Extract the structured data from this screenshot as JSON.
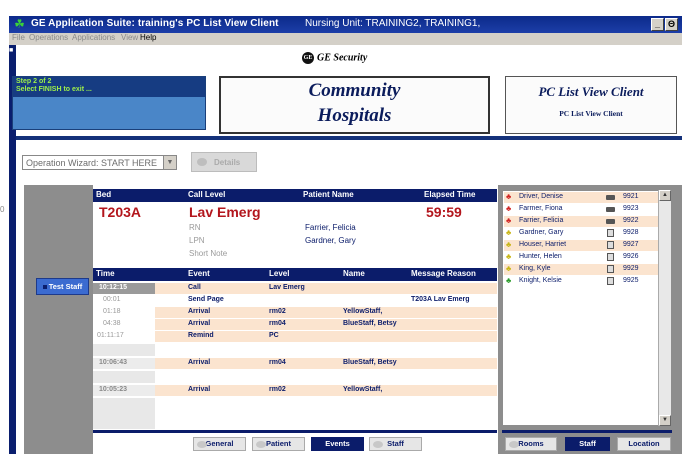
{
  "window": {
    "title": "GE Application Suite:  training's PC List View Client",
    "nursing_unit": "Nursing Unit:  TRAINING2, TRAINING1,",
    "min_label": "_",
    "restore_label": "Θ"
  },
  "menu": {
    "file": "File",
    "operations": "Operations",
    "applications": "Applications",
    "view": "View",
    "help": "Help"
  },
  "left_strip_mark": "■",
  "brand": {
    "ge_mark": "GE",
    "ge_text": "GE Security"
  },
  "step": {
    "line1": "Step 2 of 2",
    "line2": "Select FINISH to exit ..."
  },
  "hospital": {
    "line1": "Community",
    "line2": "Hospitals"
  },
  "client": {
    "line1": "PC List View Client",
    "line2": "PC List View Client"
  },
  "wizard": {
    "value": "Operation Wizard: START HERE",
    "arrow": "▼",
    "details_label": "Details"
  },
  "side_tick": "0",
  "test_staff_label": "Test Staff",
  "bed": {
    "headers": {
      "bed": "Bed",
      "call_level": "Call Level",
      "patient_name": "Patient Name",
      "elapsed": "Elapsed Time"
    },
    "bed_id": "T203A",
    "call_level": "Lav Emerg",
    "patient": "Farrier, Felicia",
    "elapsed": "59:59",
    "rn_label": "RN",
    "lpn_label": "LPN",
    "lpn_value": "Gardner, Gary",
    "short_note_label": "Short Note"
  },
  "events": {
    "headers": {
      "time": "Time",
      "event": "Event",
      "level": "Level",
      "name": "Name",
      "reason": "Message Reason"
    },
    "rows": [
      {
        "time": "10:12:15",
        "event": "Call",
        "level": "Lav Emerg",
        "name": "",
        "reason": ""
      },
      {
        "time": "00:01",
        "event": "Send Page",
        "level": "",
        "name": "",
        "reason": "T203A Lav Emerg"
      },
      {
        "time": "01:18",
        "event": "Arrival",
        "level": "rm02",
        "name": "YellowStaff,",
        "reason": ""
      },
      {
        "time": "04:38",
        "event": "Arrival",
        "level": "rm04",
        "name": "BlueStaff, Betsy",
        "reason": ""
      },
      {
        "time": "01:11:17",
        "event": "Remind",
        "level": "PC",
        "name": "",
        "reason": ""
      },
      {
        "time": "10:06:43",
        "event": "Arrival",
        "level": "rm04",
        "name": "BlueStaff, Betsy",
        "reason": ""
      },
      {
        "time": "10:05:23",
        "event": "Arrival",
        "level": "rm02",
        "name": "YellowStaff,",
        "reason": ""
      }
    ]
  },
  "tabs": {
    "general": "General",
    "patient": "Patient",
    "events": "Events",
    "staff": "Staff"
  },
  "staff_list": [
    {
      "name": "Driver, Denise",
      "ext": "9921",
      "color": "red",
      "device": "pager"
    },
    {
      "name": "Farmer, Fiona",
      "ext": "9923",
      "color": "red",
      "device": "pager"
    },
    {
      "name": "Farrier, Felicia",
      "ext": "9922",
      "color": "red",
      "device": "pager"
    },
    {
      "name": "Gardner, Gary",
      "ext": "9928",
      "color": "yellow",
      "device": "phone"
    },
    {
      "name": "Houser, Harriet",
      "ext": "9927",
      "color": "yellow",
      "device": "phone"
    },
    {
      "name": "Hunter, Helen",
      "ext": "9926",
      "color": "yellow",
      "device": "phone"
    },
    {
      "name": "King, Kyle",
      "ext": "9929",
      "color": "yellow",
      "device": "phone"
    },
    {
      "name": "Knight, Kelsie",
      "ext": "9925",
      "color": "green",
      "device": "phone"
    }
  ],
  "staff_icon_glyph": "♣",
  "scroll": {
    "up": "▲",
    "down": "▼"
  },
  "right_tabs": {
    "rooms": "Rooms",
    "staff": "Staff",
    "location": "Location"
  },
  "colors": {
    "navy": "#0b1c6a",
    "alarm_red": "#b3161d",
    "row_peach": "#fbe4cf",
    "step_green": "#9ef04a"
  }
}
